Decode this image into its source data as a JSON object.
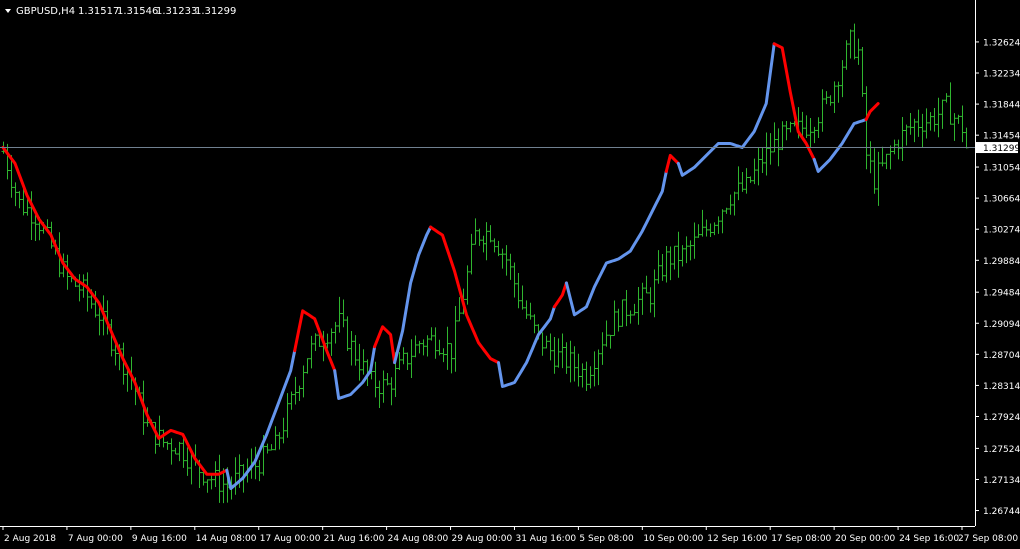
{
  "header": {
    "symbol_label": "GBPUSD,H4",
    "open": "1.31517",
    "high": "1.31546",
    "low": "1.31233",
    "close": "1.31299"
  },
  "colors": {
    "background": "#000000",
    "bars": "#2fb52f",
    "ma_up": "#6495ed",
    "ma_down": "#ff0000",
    "price_line": "#708090",
    "text": "#ffffff"
  },
  "chart_data": {
    "type": "line",
    "ylim": [
      1.2655,
      1.331
    ],
    "y_ticks": [
      "1.32624",
      "1.32234",
      "1.31844",
      "1.31454",
      "1.31054",
      "1.30664",
      "1.30274",
      "1.29884",
      "1.29484",
      "1.29094",
      "1.28704",
      "1.28314",
      "1.27924",
      "1.27524",
      "1.27134",
      "1.26744"
    ],
    "y_tick_values": [
      1.32624,
      1.32234,
      1.31844,
      1.31454,
      1.31054,
      1.30664,
      1.30274,
      1.29884,
      1.29484,
      1.29094,
      1.28704,
      1.28314,
      1.27924,
      1.27524,
      1.27134,
      1.26744
    ],
    "current_price": "1.31299",
    "x_ticks": [
      "2 Aug 2018",
      "7 Aug 00:00",
      "9 Aug 16:00",
      "14 Aug 08:00",
      "17 Aug 00:00",
      "21 Aug 16:00",
      "24 Aug 08:00",
      "29 Aug 00:00",
      "31 Aug 16:00",
      "5 Sep 08:00",
      "10 Sep 00:00",
      "12 Sep 16:00",
      "17 Sep 08:00",
      "20 Sep 00:00",
      "24 Sep 16:00",
      "27 Sep 08:00"
    ],
    "x_tick_index": [
      0,
      16,
      32,
      48,
      64,
      80,
      96,
      112,
      128,
      144,
      160,
      176,
      192,
      208,
      224,
      240
    ],
    "bar_count": 242,
    "price_anchors": [
      [
        0,
        1.3125
      ],
      [
        4,
        1.306
      ],
      [
        8,
        1.3045
      ],
      [
        12,
        1.3005
      ],
      [
        16,
        1.2965
      ],
      [
        20,
        1.295
      ],
      [
        24,
        1.292
      ],
      [
        28,
        1.288
      ],
      [
        32,
        1.284
      ],
      [
        36,
        1.278
      ],
      [
        40,
        1.276
      ],
      [
        44,
        1.2755
      ],
      [
        48,
        1.273
      ],
      [
        52,
        1.2715
      ],
      [
        56,
        1.2705
      ],
      [
        60,
        1.272
      ],
      [
        64,
        1.2735
      ],
      [
        68,
        1.2755
      ],
      [
        72,
        1.281
      ],
      [
        76,
        1.287
      ],
      [
        80,
        1.2895
      ],
      [
        84,
        1.291
      ],
      [
        88,
        1.287
      ],
      [
        92,
        1.2835
      ],
      [
        96,
        1.283
      ],
      [
        100,
        1.286
      ],
      [
        104,
        1.2885
      ],
      [
        108,
        1.289
      ],
      [
        112,
        1.2875
      ],
      [
        114,
        1.292
      ],
      [
        118,
        1.302
      ],
      [
        122,
        1.3025
      ],
      [
        126,
        1.299
      ],
      [
        130,
        1.293
      ],
      [
        134,
        1.289
      ],
      [
        138,
        1.287
      ],
      [
        142,
        1.286
      ],
      [
        146,
        1.2845
      ],
      [
        150,
        1.289
      ],
      [
        154,
        1.292
      ],
      [
        158,
        1.2935
      ],
      [
        162,
        1.2945
      ],
      [
        166,
        1.299
      ],
      [
        170,
        1.2995
      ],
      [
        174,
        1.3015
      ],
      [
        178,
        1.304
      ],
      [
        182,
        1.307
      ],
      [
        186,
        1.308
      ],
      [
        190,
        1.3115
      ],
      [
        194,
        1.314
      ],
      [
        198,
        1.315
      ],
      [
        202,
        1.316
      ],
      [
        206,
        1.3185
      ],
      [
        210,
        1.3235
      ],
      [
        212,
        1.3262
      ],
      [
        214,
        1.325
      ],
      [
        216,
        1.312
      ],
      [
        218,
        1.309
      ],
      [
        220,
        1.3105
      ],
      [
        224,
        1.314
      ],
      [
        228,
        1.316
      ],
      [
        232,
        1.3165
      ],
      [
        236,
        1.318
      ],
      [
        240,
        1.3155
      ],
      [
        241,
        1.313
      ]
    ],
    "ma_anchors": [
      [
        0,
        1.313
      ],
      [
        3,
        1.311
      ],
      [
        6,
        1.307
      ],
      [
        9,
        1.304
      ],
      [
        12,
        1.302
      ],
      [
        15,
        1.2985
      ],
      [
        18,
        1.2965
      ],
      [
        21,
        1.2955
      ],
      [
        24,
        1.2935
      ],
      [
        27,
        1.29
      ],
      [
        30,
        1.2865
      ],
      [
        33,
        1.2835
      ],
      [
        36,
        1.2795
      ],
      [
        39,
        1.2765
      ],
      [
        42,
        1.2775
      ],
      [
        45,
        1.277
      ],
      [
        48,
        1.274
      ],
      [
        51,
        1.272
      ],
      [
        54,
        1.272
      ],
      [
        56,
        1.2725
      ],
      [
        57,
        1.2702
      ],
      [
        60,
        1.2715
      ],
      [
        63,
        1.2735
      ],
      [
        66,
        1.277
      ],
      [
        69,
        1.281
      ],
      [
        72,
        1.285
      ],
      [
        73,
        1.2875
      ],
      [
        75,
        1.2925
      ],
      [
        78,
        1.2915
      ],
      [
        81,
        1.2875
      ],
      [
        83,
        1.285
      ],
      [
        84,
        1.2815
      ],
      [
        87,
        1.282
      ],
      [
        90,
        1.2835
      ],
      [
        92,
        1.285
      ],
      [
        93,
        1.288
      ],
      [
        95,
        1.2905
      ],
      [
        97,
        1.2895
      ],
      [
        98,
        1.286
      ],
      [
        100,
        1.29
      ],
      [
        102,
        1.296
      ],
      [
        104,
        1.2995
      ],
      [
        106,
        1.302
      ],
      [
        107,
        1.303
      ],
      [
        110,
        1.302
      ],
      [
        113,
        1.2975
      ],
      [
        116,
        1.292
      ],
      [
        119,
        1.2885
      ],
      [
        122,
        1.2865
      ],
      [
        124,
        1.286
      ],
      [
        125,
        1.283
      ],
      [
        128,
        1.2835
      ],
      [
        131,
        1.286
      ],
      [
        134,
        1.2895
      ],
      [
        137,
        1.2915
      ],
      [
        138,
        1.293
      ],
      [
        140,
        1.2945
      ],
      [
        141,
        1.296
      ],
      [
        143,
        1.292
      ],
      [
        146,
        1.293
      ],
      [
        148,
        1.2955
      ],
      [
        151,
        1.2985
      ],
      [
        154,
        1.299
      ],
      [
        157,
        1.3
      ],
      [
        160,
        1.3025
      ],
      [
        163,
        1.3055
      ],
      [
        165,
        1.3075
      ],
      [
        166,
        1.31
      ],
      [
        167,
        1.312
      ],
      [
        169,
        1.311
      ],
      [
        170,
        1.3095
      ],
      [
        173,
        1.3105
      ],
      [
        176,
        1.312
      ],
      [
        179,
        1.3135
      ],
      [
        182,
        1.3135
      ],
      [
        185,
        1.313
      ],
      [
        188,
        1.315
      ],
      [
        191,
        1.3185
      ],
      [
        193,
        1.326
      ],
      [
        195,
        1.3255
      ],
      [
        197,
        1.32
      ],
      [
        199,
        1.315
      ],
      [
        201,
        1.3135
      ],
      [
        203,
        1.3115
      ],
      [
        204,
        1.31
      ],
      [
        207,
        1.3115
      ],
      [
        210,
        1.3135
      ],
      [
        213,
        1.316
      ],
      [
        216,
        1.3165
      ],
      [
        217,
        1.3175
      ],
      [
        219,
        1.3185
      ]
    ],
    "ma_down_segments": [
      [
        0,
        56
      ],
      [
        73,
        83
      ],
      [
        93,
        98
      ],
      [
        107,
        124
      ],
      [
        138,
        141
      ],
      [
        166,
        169
      ],
      [
        193,
        203
      ],
      [
        216,
        219
      ]
    ]
  }
}
